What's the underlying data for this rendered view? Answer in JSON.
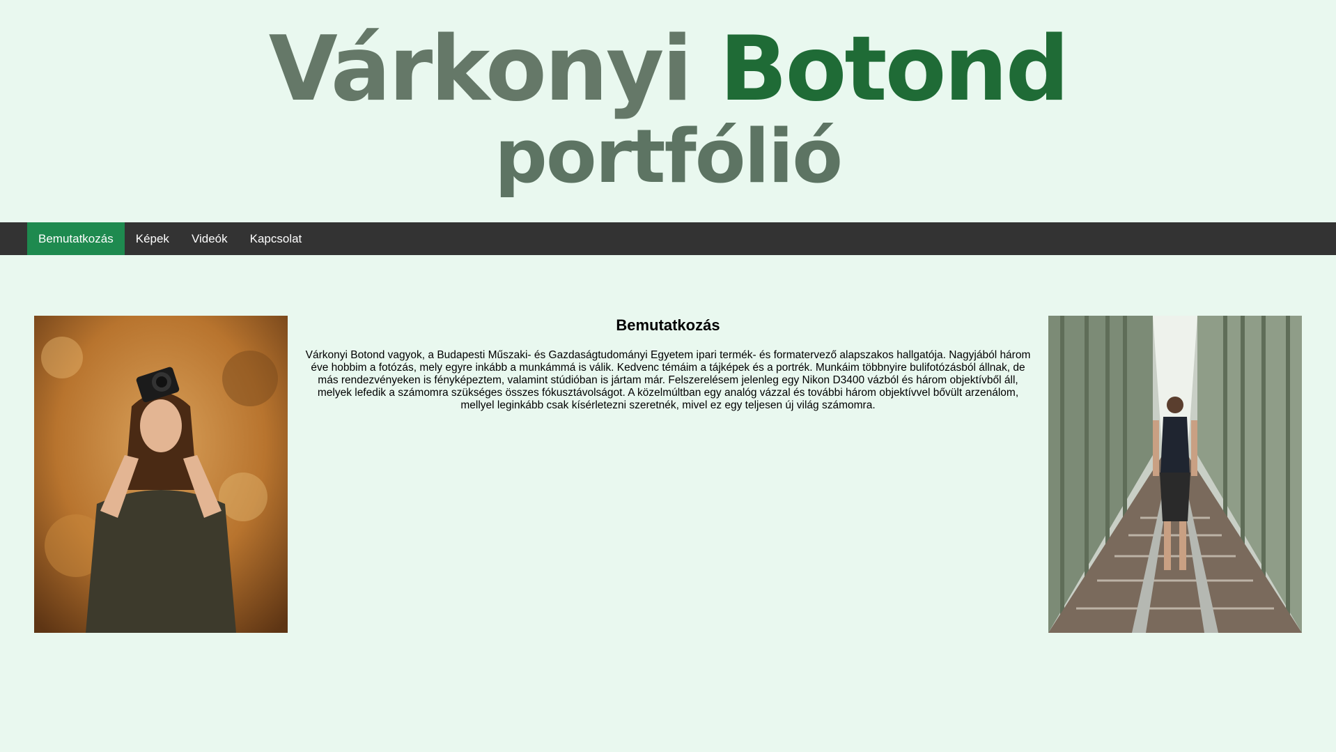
{
  "header": {
    "title_first": "Várkonyi",
    "title_last": "Botond",
    "subtitle": "portfólió"
  },
  "nav": {
    "items": [
      "Bemutatkozás",
      "Képek",
      "Videók",
      "Kapcsolat"
    ],
    "active": "Bemutatkozás"
  },
  "main": {
    "heading": "Bemutatkozás",
    "text": "Várkonyi Botond vagyok, a Budapesti Műszaki- és Gazdaságtudományi Egyetem ipari termék- és formatervező alapszakos hallgatója. Nagyjából három éve hobbim a fotózás, mely egyre inkább a munkámmá is válik. Kedvenc témáim a tájképek és a portrék. Munkáim többnyire bulifotózásból állnak, de más rendezvényeken is fényképeztem, valamint stúdióban is jártam már. Felszerelésem jelenleg egy Nikon D3400 vázból és három objektívből áll, melyek lefedik a számomra szükséges összes fókusztávolságot. A közelmúltban egy analóg vázzal és további három objektívvel bővült arzenálom, mellyel leginkább csak kísérletezni szeretnék, mivel ez egy teljesen új világ számomra."
  },
  "colors": {
    "background": "#e9f8ef",
    "nav_bg": "#333333",
    "nav_active": "#1e8a4f",
    "title_grey": "#657868",
    "title_green": "#1f6b36"
  }
}
